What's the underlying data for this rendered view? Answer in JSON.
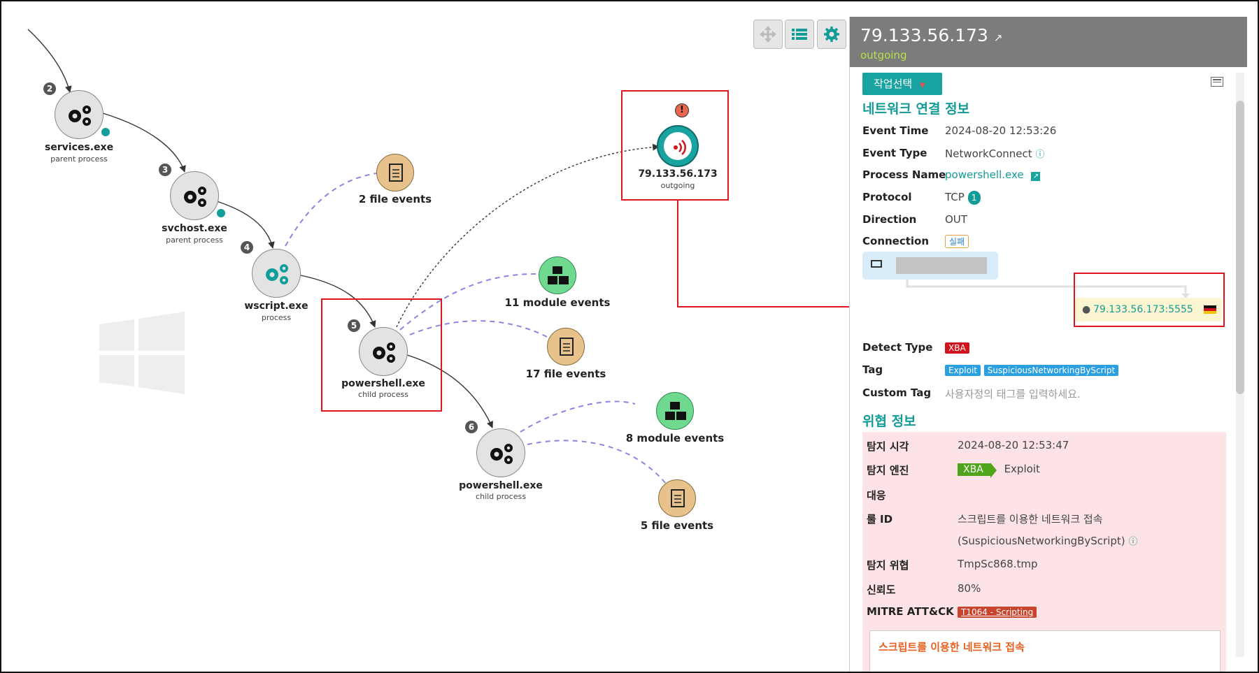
{
  "graph": {
    "nodes": [
      {
        "id": "services",
        "num": "2",
        "name": "services.exe",
        "sub": "parent process"
      },
      {
        "id": "svchost",
        "num": "3",
        "name": "svchost.exe",
        "sub": "parent process"
      },
      {
        "id": "wscript",
        "num": "4",
        "name": "wscript.exe",
        "sub": "process"
      },
      {
        "id": "powershell1",
        "num": "5",
        "name": "powershell.exe",
        "sub": "child process"
      },
      {
        "id": "powershell2",
        "num": "6",
        "name": "powershell.exe",
        "sub": "child process"
      }
    ],
    "events": {
      "file_2": "2 file events",
      "module_11": "11 module events",
      "file_17": "17 file events",
      "module_8": "8 module events",
      "file_5": "5 file events"
    },
    "network": {
      "ip": "79.133.56.173",
      "direction": "outgoing"
    }
  },
  "panel": {
    "title": "79.133.56.173",
    "subtitle": "outgoing",
    "action_button": "작업선택",
    "network_section": "네트워크 연결 정보",
    "fields": {
      "event_time": {
        "label": "Event Time",
        "value": "2024-08-20 12:53:26"
      },
      "event_type": {
        "label": "Event Type",
        "value": "NetworkConnect"
      },
      "process_name": {
        "label": "Process Name",
        "value": "powershell.exe"
      },
      "protocol": {
        "label": "Protocol",
        "value": "TCP",
        "badge": "1"
      },
      "direction": {
        "label": "Direction",
        "value": "OUT"
      },
      "connection": {
        "label": "Connection",
        "value": "실패"
      }
    },
    "remote_endpoint": "79.133.56.173:5555",
    "detect_type": {
      "label": "Detect Type",
      "value": "XBA"
    },
    "tag": {
      "label": "Tag",
      "values": [
        "Exploit",
        "SuspiciousNetworkingByScript"
      ]
    },
    "custom_tag": {
      "label": "Custom Tag",
      "placeholder": "사용자정의 태그를 입력하세요."
    },
    "threat_section": "위협 정보",
    "threat": {
      "detect_time": {
        "label": "탐지 시각",
        "value": "2024-08-20 12:53:47"
      },
      "detect_engine": {
        "label": "탐지 엔진",
        "engine": "XBA",
        "value": "Exploit"
      },
      "response": {
        "label": "대응",
        "value": ""
      },
      "rule_id": {
        "label": "룰 ID",
        "line1": "스크립트를 이용한 네트워크 접속",
        "line2": "(SuspiciousNetworkingByScript)"
      },
      "detect_threat": {
        "label": "탐지 위협",
        "value": "TmpSc868.tmp"
      },
      "confidence": {
        "label": "신뢰도",
        "value": "80%"
      },
      "mitre": {
        "label": "MITRE ATT&CK",
        "value": "T1064 - Scripting"
      },
      "card_title": "스크립트를 이용한 네트워크 접속"
    }
  },
  "colors": {
    "teal": "#139b97",
    "red_box": "#e0141e",
    "threat_bg": "#fde3e6",
    "xba_red": "#d0141e",
    "xba_green": "#4ea51b",
    "tag_blue": "#2aa0e0",
    "mitre": "#c8442c"
  }
}
